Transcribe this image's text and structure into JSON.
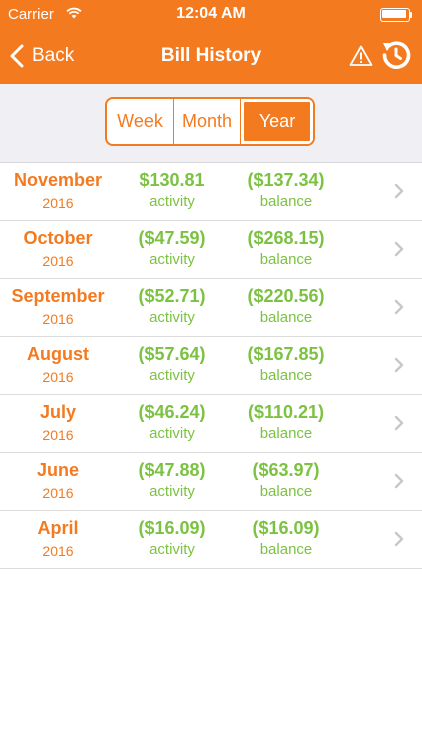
{
  "status_bar": {
    "carrier": "Carrier",
    "time": "12:04 AM"
  },
  "nav": {
    "back_label": "Back",
    "title": "Bill History"
  },
  "segments": [
    "Week",
    "Month",
    "Year"
  ],
  "selected_segment": "Year",
  "rows": [
    {
      "month": "November",
      "year": "2016",
      "activity": "$130.81",
      "activity_label": "activity",
      "balance": "($137.34)",
      "balance_label": "balance"
    },
    {
      "month": "October",
      "year": "2016",
      "activity": "($47.59)",
      "activity_label": "activity",
      "balance": "($268.15)",
      "balance_label": "balance"
    },
    {
      "month": "September",
      "year": "2016",
      "activity": "($52.71)",
      "activity_label": "activity",
      "balance": "($220.56)",
      "balance_label": "balance"
    },
    {
      "month": "August",
      "year": "2016",
      "activity": "($57.64)",
      "activity_label": "activity",
      "balance": "($167.85)",
      "balance_label": "balance"
    },
    {
      "month": "July",
      "year": "2016",
      "activity": "($46.24)",
      "activity_label": "activity",
      "balance": "($110.21)",
      "balance_label": "balance"
    },
    {
      "month": "June",
      "year": "2016",
      "activity": "($47.88)",
      "activity_label": "activity",
      "balance": "($63.97)",
      "balance_label": "balance"
    },
    {
      "month": "April",
      "year": "2016",
      "activity": "($16.09)",
      "activity_label": "activity",
      "balance": "($16.09)",
      "balance_label": "balance"
    }
  ],
  "icons": {
    "back": "chevron-left-icon",
    "warning": "warning-triangle-icon",
    "refresh": "refresh-icon",
    "row_disclosure": "chevron-right-icon",
    "wifi": "wifi-icon",
    "battery": "battery-icon"
  },
  "colors": {
    "accent": "#f47a20",
    "positive": "#7cc242",
    "segment_bg": "#efeff4"
  }
}
